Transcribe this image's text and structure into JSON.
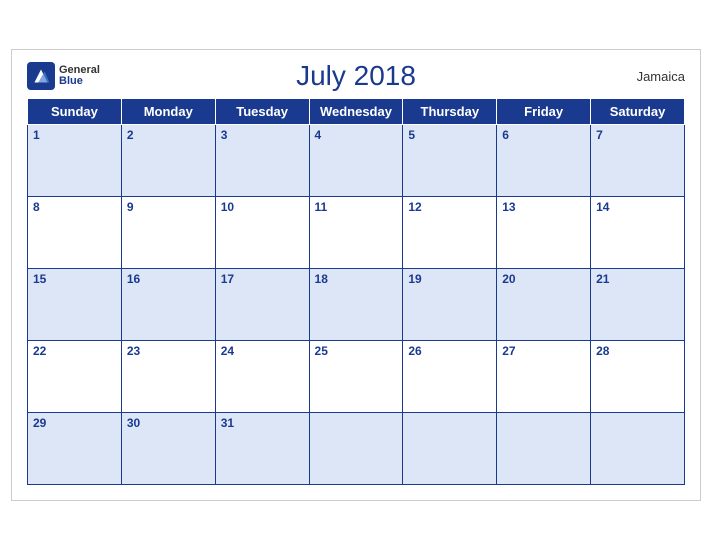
{
  "calendar": {
    "title": "July 2018",
    "country": "Jamaica",
    "days_of_week": [
      "Sunday",
      "Monday",
      "Tuesday",
      "Wednesday",
      "Thursday",
      "Friday",
      "Saturday"
    ],
    "weeks": [
      [
        1,
        2,
        3,
        4,
        5,
        6,
        7
      ],
      [
        8,
        9,
        10,
        11,
        12,
        13,
        14
      ],
      [
        15,
        16,
        17,
        18,
        19,
        20,
        21
      ],
      [
        22,
        23,
        24,
        25,
        26,
        27,
        28
      ],
      [
        29,
        30,
        31,
        null,
        null,
        null,
        null
      ]
    ]
  },
  "logo": {
    "general": "General",
    "blue": "Blue"
  }
}
